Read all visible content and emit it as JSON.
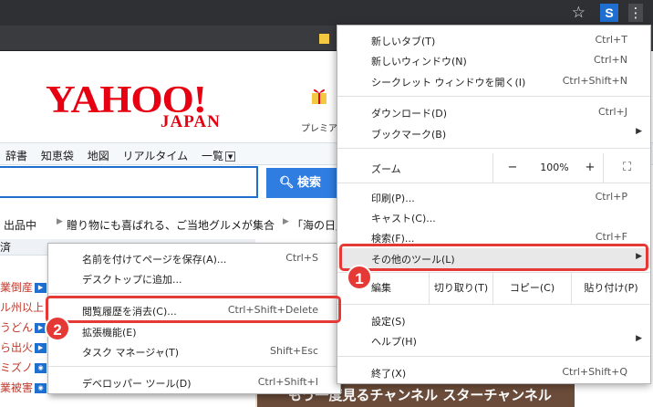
{
  "chrome": {
    "star_icon": "☆",
    "ext_letter": "S",
    "kebab_icon": "⋮"
  },
  "yahoo": {
    "logo": "YAHOO!",
    "logo_sub": "JAPAN",
    "premium": "プレミアム",
    "nav": [
      "辞書",
      "知恵袋",
      "地図",
      "リアルタイム",
      "一覧"
    ],
    "search_button": "検索",
    "ticker": [
      "出品中",
      "贈り物にも喜ばれる、ご当地グルメが集合",
      "「海の日」"
    ],
    "economy": "済",
    "left_items": [
      "業倒産",
      "ル州以上",
      "うどん",
      "ら出火",
      "ミズノ",
      "業被害"
    ],
    "ad_text": "もう一度見るチャンネル スターチャンネル"
  },
  "context_menu": {
    "items": [
      {
        "label": "名前を付けてページを保存(A)...",
        "shortcut": "Ctrl+S"
      },
      {
        "label": "デスクトップに追加...",
        "shortcut": ""
      },
      {
        "label": "閲覧履歴を消去(C)...",
        "shortcut": "Ctrl+Shift+Delete"
      },
      {
        "label": "拡張機能(E)",
        "shortcut": ""
      },
      {
        "label": "タスク マネージャ(T)",
        "shortcut": "Shift+Esc"
      },
      {
        "label": "デベロッパー ツール(D)",
        "shortcut": "Ctrl+Shift+I"
      }
    ]
  },
  "main_menu": {
    "new_tab": {
      "label": "新しいタブ(T)",
      "shortcut": "Ctrl+T"
    },
    "new_window": {
      "label": "新しいウィンドウ(N)",
      "shortcut": "Ctrl+N"
    },
    "incognito": {
      "label": "シークレット ウィンドウを開く(I)",
      "shortcut": "Ctrl+Shift+N"
    },
    "downloads": {
      "label": "ダウンロード(D)",
      "shortcut": "Ctrl+J"
    },
    "bookmarks": {
      "label": "ブックマーク(B)"
    },
    "zoom": {
      "label": "ズーム",
      "minus": "−",
      "value": "100%",
      "plus": "+",
      "fullscreen": "⛶"
    },
    "print": {
      "label": "印刷(P)...",
      "shortcut": "Ctrl+P"
    },
    "cast": {
      "label": "キャスト(C)..."
    },
    "find": {
      "label": "検索(F)...",
      "shortcut": "Ctrl+F"
    },
    "more_tools": {
      "label": "その他のツール(L)"
    },
    "edit": {
      "label": "編集",
      "cut": "切り取り(T)",
      "copy": "コピー(C)",
      "paste": "貼り付け(P)"
    },
    "settings": {
      "label": "設定(S)"
    },
    "help": {
      "label": "ヘルプ(H)"
    },
    "exit": {
      "label": "終了(X)",
      "shortcut": "Ctrl+Shift+Q"
    }
  },
  "annotations": {
    "step1": "1",
    "step2": "2"
  },
  "colors": {
    "annotation": "#e53935",
    "yahoo_red": "#e60012",
    "search_blue": "#2f7de1"
  }
}
